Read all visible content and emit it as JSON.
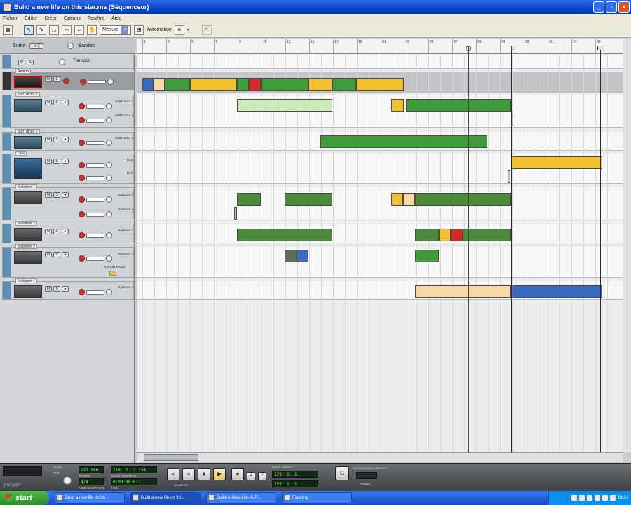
{
  "window": {
    "title": "Build a new life on this star.rns (Séquenceur)"
  },
  "menu": [
    "Fichier",
    "Éditer",
    "Créer",
    "Options",
    "Fenêtre",
    "Aide"
  ],
  "toolbar": {
    "snap_value": "Mesure",
    "automation_label": "Automation"
  },
  "tracklist": {
    "header": {
      "out_label": "Sortie",
      "lanes_label": "Bandes"
    },
    "transport_row": "Transport",
    "tracks": [
      {
        "name": "Rebirth"
      },
      {
        "name": "SubTractor 1",
        "lanes": [
          "SubTractor 1",
          "SubTractor 1"
        ]
      },
      {
        "name": "SubTractor 2",
        "lanes": [
          "SubTractor 2"
        ]
      },
      {
        "name": "Dr.R",
        "lanes": [
          "Dr.R",
          "Dr.R"
        ]
      },
      {
        "name": "Malstrom 1",
        "lanes": [
          "Malstrom 1",
          "Malstrom 1"
        ]
      },
      {
        "name": "Malstrom 2",
        "lanes": [
          "Malstrom 2"
        ]
      },
      {
        "name": "Malstrom 3",
        "lanes": [
          "Malstrom 3"
        ],
        "extra": "Refresh 2 Audio"
      },
      {
        "name": "Malstrom 4",
        "lanes": [
          "Malstrom 4"
        ]
      }
    ]
  },
  "ruler": {
    "bars": [
      "1",
      "3",
      "5",
      "7",
      "9",
      "11",
      "13",
      "15",
      "17",
      "19",
      "21",
      "23",
      "25",
      "27",
      "29",
      "31",
      "33",
      "35",
      "37",
      "39"
    ]
  },
  "transport": {
    "tempo": "125.000",
    "signature": "4/4",
    "position": "118. 2. 3.134",
    "time": "0:03:30:622",
    "loop_left": "125. 1. 1.",
    "loop_right": "155. 1. 1.",
    "loop_label": "LOOP ON/OFF",
    "tempo_label": "TEMPO",
    "signature_label": "TIME SIGNATURE",
    "position_label": "SONG POSITION",
    "time_label": "TIME",
    "brand": "transport",
    "click_label": "CLICK",
    "pre_label": "PRE",
    "quantize_label": "QUANTIZE",
    "automation_label": "AUTOMATION OVERRIDE",
    "reset_label": "RESET"
  },
  "taskbar": {
    "start": "start",
    "tasks": [
      "Build a new life on thi...",
      "Build a new life on thi...",
      "Build-A-New-Life-In-T...",
      "Flashing"
    ],
    "clock": "19:14"
  }
}
